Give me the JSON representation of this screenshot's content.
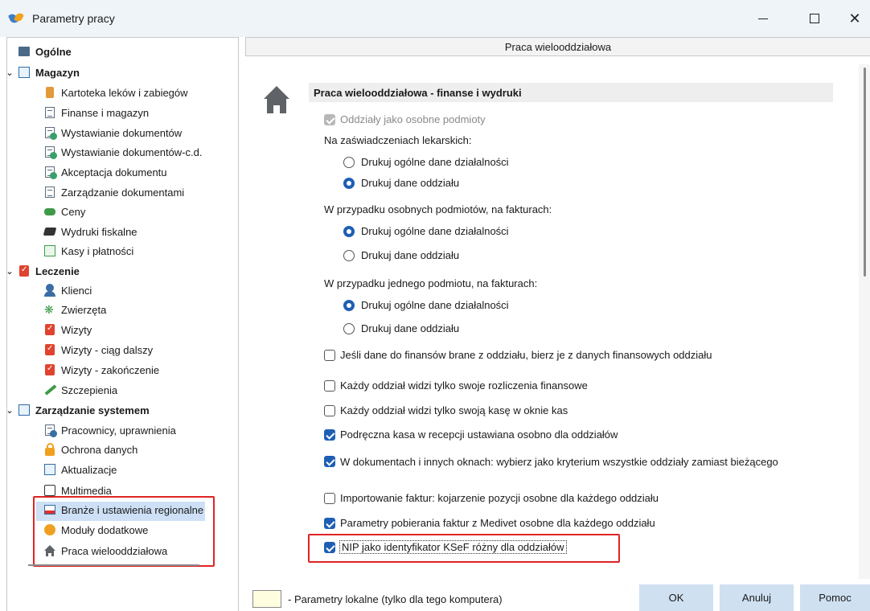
{
  "window": {
    "title": "Parametry pracy"
  },
  "tree": {
    "items": [
      {
        "label": "Ogólne",
        "bold": true,
        "level": 0,
        "icon": "database-icon"
      },
      {
        "label": "Magazyn",
        "bold": true,
        "level": 0,
        "icon": "warehouse-icon",
        "expanded": true
      },
      {
        "label": "Kartoteka leków i zabiegów",
        "level": 1,
        "icon": "medicine-icon"
      },
      {
        "label": "Finanse i magazyn",
        "level": 1,
        "icon": "document-icon"
      },
      {
        "label": "Wystawianie dokumentów",
        "level": 1,
        "icon": "document-add-icon"
      },
      {
        "label": "Wystawianie dokumentów-c.d.",
        "level": 1,
        "icon": "document-add-icon"
      },
      {
        "label": "Akceptacja dokumentu",
        "level": 1,
        "icon": "document-add-icon"
      },
      {
        "label": "Zarządzanie dokumentami",
        "level": 1,
        "icon": "document-icon"
      },
      {
        "label": "Ceny",
        "level": 1,
        "icon": "coins-icon"
      },
      {
        "label": "Wydruki fiskalne",
        "level": 1,
        "icon": "printer-icon"
      },
      {
        "label": "Kasy i płatności",
        "level": 1,
        "icon": "cash-register-icon"
      },
      {
        "label": "Leczenie",
        "bold": true,
        "level": 0,
        "icon": "clipboard-icon",
        "expanded": true
      },
      {
        "label": "Klienci",
        "level": 1,
        "icon": "person-icon"
      },
      {
        "label": "Zwierzęta",
        "level": 1,
        "icon": "paw-icon"
      },
      {
        "label": "Wizyty",
        "level": 1,
        "icon": "clipboard-icon"
      },
      {
        "label": "Wizyty - ciąg dalszy",
        "level": 1,
        "icon": "clipboard-icon"
      },
      {
        "label": "Wizyty - zakończenie",
        "level": 1,
        "icon": "clipboard-icon"
      },
      {
        "label": "Szczepienia",
        "level": 1,
        "icon": "syringe-icon"
      },
      {
        "label": "Zarządzanie systemem",
        "bold": true,
        "level": 0,
        "icon": "system-icon",
        "expanded": true
      },
      {
        "label": "Pracownicy, uprawnienia",
        "level": 1,
        "icon": "users-icon"
      },
      {
        "label": "Ochrona danych",
        "level": 1,
        "icon": "lock-icon"
      },
      {
        "label": "Aktualizacje",
        "level": 1,
        "icon": "update-icon"
      },
      {
        "label": "Multimedia",
        "level": 1,
        "icon": "multimedia-icon"
      },
      {
        "label": "Branże i ustawienia regionalne",
        "level": 1,
        "icon": "flag-icon"
      },
      {
        "label": "Moduły dodatkowe",
        "level": 1,
        "icon": "modules-icon"
      },
      {
        "label": "Praca wielooddziałowa",
        "level": 1,
        "icon": "home-icon",
        "selected": true
      }
    ]
  },
  "panel": {
    "header": "Praca wielooddziałowa",
    "section_title": "Praca wielooddziałowa - finanse i wydruki",
    "options": {
      "separate_entities": "Oddziały jako osobne podmioty",
      "certificates_label": "Na zaświadczeniach lekarskich:",
      "cert_general": "Drukuj ogólne dane działalności",
      "cert_branch": "Drukuj dane oddziału",
      "separate_invoices_label": "W przypadku osobnych podmiotów, na fakturach:",
      "sep_general": "Drukuj ogólne dane działalności",
      "sep_branch": "Drukuj dane oddziału",
      "single_invoices_label": "W przypadku jednego podmiotu, na fakturach:",
      "single_general": "Drukuj ogólne dane działalności",
      "single_branch": "Drukuj dane oddziału",
      "finance_data": "Jeśli dane do finansów brane z oddziału, bierz je z danych finansowych oddziału",
      "own_settlements": "Każdy oddział widzi tylko swoje rozliczenia finansowe",
      "own_cash": "Każdy oddział widzi tylko swoją kasę w oknie kas",
      "petty_cash": "Podręczna kasa w recepcji ustawiana osobno dla oddziałów",
      "all_branches": "W dokumentach i innych oknach: wybierz jako kryterium wszystkie oddziały zamiast bieżącego",
      "import_invoices": "Importowanie faktur: kojarzenie pozycji osobne dla każdego oddziału",
      "medivet_params": "Parametry pobierania faktur z Medivet osobne dla każdego oddziału",
      "nip_ksef": "NIP jako identyfikator KSeF różny dla oddziałów"
    }
  },
  "footer": {
    "legend_text": "- Parametry lokalne (tylko dla tego komputera)",
    "ok": "OK",
    "cancel": "Anuluj",
    "help": "Pomoc"
  },
  "colors": {
    "accent": "#1e5fb4",
    "highlight": "#e02424",
    "button": "#cfe0f1"
  }
}
